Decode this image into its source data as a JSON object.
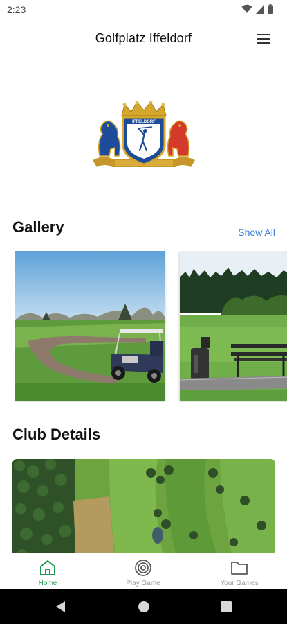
{
  "status_bar": {
    "time": "2:23"
  },
  "app_bar": {
    "title": "Golfplatz Iffeldorf",
    "menu_icon": "hamburger-menu-icon"
  },
  "logo": {
    "crest_text": "IFFELDORF",
    "colors": {
      "gold": "#d6a72a",
      "blue": "#1d4c9a",
      "red": "#d33a2a"
    }
  },
  "gallery": {
    "title": "Gallery",
    "show_all_label": "Show All",
    "items": [
      {
        "alt": "Golf cart on fairway path"
      },
      {
        "alt": "Driving range with bench"
      }
    ]
  },
  "club_details": {
    "title": "Club Details",
    "image_alt": "Aerial view of golf course"
  },
  "bottom_nav": {
    "items": [
      {
        "label": "Home",
        "icon": "home-icon",
        "active": true
      },
      {
        "label": "Play Game",
        "icon": "target-icon",
        "active": false
      },
      {
        "label": "Your Games",
        "icon": "folder-icon",
        "active": false
      }
    ],
    "active_color": "#1f9a55",
    "inactive_color": "#9a9a9a"
  },
  "system_nav": {
    "buttons": [
      "back-icon",
      "home-circle-icon",
      "recents-icon"
    ]
  }
}
